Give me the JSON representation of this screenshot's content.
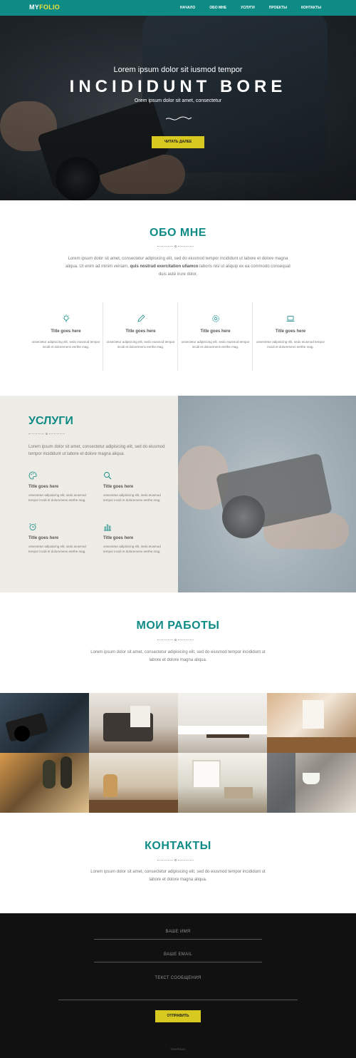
{
  "brand": {
    "part1": "MY",
    "part2": "FOLIO"
  },
  "nav": [
    "НАЧАЛО",
    "ОБО МНЕ",
    "УСЛУГИ",
    "ПРОЕКТЫ",
    "КОНТАКТЫ"
  ],
  "hero": {
    "subtitle": "Lorem ipsum dolor sit iusmod tempor",
    "title": "INCIDIDUNT BORE",
    "tagline": "Orem ipsum dolor sit amet, consectetur",
    "button": "ЧИТАТЬ ДАЛЕЕ"
  },
  "about": {
    "title": "ОБО МНЕ",
    "text_before": "Lorem ipsum dolor sit amet, consectetur adipisicing elit, sed do eiusmod tempor incididunt ut labore et dolore magna aliqua. Ut enim ad minim veniam, ",
    "text_bold": "quis nostrud exercitation ullamco",
    "text_after": " laboris nisi ut aliquip ex ea commodo consequat duis aute irure dolor.",
    "features": [
      {
        "icon": "lightbulb-icon",
        "title": "Title goes here",
        "text": "onsectetur adipisicing elit, sedo eiusmod tempor incidi et doloremens eerthe mag."
      },
      {
        "icon": "pencil-icon",
        "title": "Title goes here",
        "text": "onsectetur adipisicing elit, sedo eiusmod tempor incidi et doloremens eerthe mag."
      },
      {
        "icon": "gear-icon",
        "title": "Title goes here",
        "text": "onsectetur adipisicing elit, sedo eiusmod tempor incidi et doloremens eerthe mag."
      },
      {
        "icon": "laptop-icon",
        "title": "Title goes here",
        "text": "onsectetur adipisicing elit, sedo eiusmod tempor incidi et doloremens eerthe mag."
      }
    ]
  },
  "services": {
    "title": "УСЛУГИ",
    "text": "Lorem ipsum dolor sit amet, consectetur adipisicing elit, sed do eiusmod tempor incididunt ut labore et dolore magna aliqua.",
    "items": [
      {
        "icon": "palette-icon",
        "title": "Title goes here",
        "text": "onsectetur adipisicing elit, sedo eiusmod tempor incidi et doloremens eerthe mag."
      },
      {
        "icon": "magnifier-icon",
        "title": "Title goes here",
        "text": "onsectetur adipisicing elit, sedo eiusmod tempor incidi et doloremens eerthe mag."
      },
      {
        "icon": "alarm-clock-icon",
        "title": "Title goes here",
        "text": "onsectetur adipisicing elit, sedo eiusmod tempor incidi et doloremens eerthe mag."
      },
      {
        "icon": "bar-chart-icon",
        "title": "Title goes here",
        "text": "onsectetur adipisicing elit, sedo eiusmod tempor incidi et doloremens eerthe mag."
      }
    ]
  },
  "works": {
    "title": "МОИ РАБОТЫ",
    "text": "Lorem ipsum dolor sit amet, consectetur adipisicing elit, sed do eiusmod tempor incididunt ut labore et dolore magna aliqua."
  },
  "contacts": {
    "title": "КОНТАКТЫ",
    "text": "Lorem ipsum dolor sit amet, consectetur adipisicing elit, sed do eiusmod tempor incididunt ut labore et dolore magna aliqua.",
    "name_placeholder": "ВАШЕ ИМЯ",
    "email_placeholder": "ВАШЕ EMAIL",
    "message_placeholder": "ТЕКСТ СООБЩЕНИЯ",
    "send_button": "ОТПРАВИТЬ",
    "copyright": "©MYFOLIO"
  },
  "colors": {
    "accent": "#0f8b86",
    "button": "#d7c91f",
    "footer": "#111111",
    "services_bg": "#eeece6"
  }
}
